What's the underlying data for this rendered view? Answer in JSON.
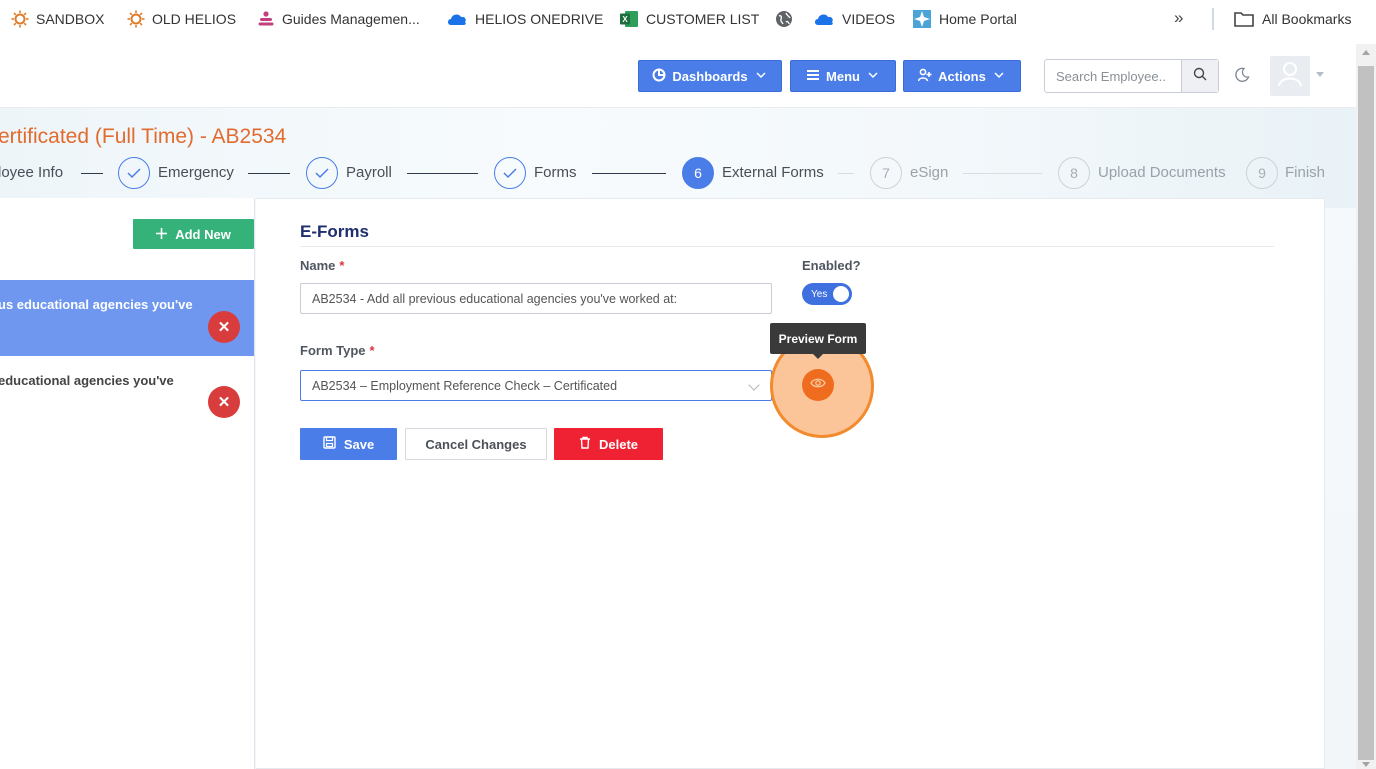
{
  "bookmarks": {
    "items": [
      {
        "label": "SANDBOX",
        "icon": "sun-icon"
      },
      {
        "label": "OLD HELIOS",
        "icon": "sun-icon"
      },
      {
        "label": "Guides Managemen...",
        "icon": "people-icon"
      },
      {
        "label": "HELIOS ONEDRIVE",
        "icon": "cloud-icon"
      },
      {
        "label": "CUSTOMER LIST",
        "icon": "excel-icon"
      },
      {
        "label": "",
        "icon": "globe-icon"
      },
      {
        "label": "VIDEOS",
        "icon": "cloud-icon"
      },
      {
        "label": "Home Portal",
        "icon": "star-icon"
      }
    ],
    "more_label": "»",
    "all_bookmarks_label": "All Bookmarks"
  },
  "header": {
    "dashboards_label": "Dashboards",
    "menu_label": "Menu",
    "actions_label": "Actions",
    "search_placeholder": "Search Employee..",
    "accent_color": "#4a7de8"
  },
  "page": {
    "title": "ertificated (Full Time) - AB2534"
  },
  "stepper": {
    "steps": [
      {
        "label": "loyee Info",
        "state": "done"
      },
      {
        "label": "Emergency",
        "state": "done"
      },
      {
        "label": "Payroll",
        "state": "done"
      },
      {
        "label": "Forms",
        "state": "done"
      },
      {
        "number": "6",
        "label": "External Forms",
        "state": "active"
      },
      {
        "number": "7",
        "label": "eSign",
        "state": "pending"
      },
      {
        "number": "8",
        "label": "Upload Documents",
        "state": "pending"
      },
      {
        "number": "9",
        "label": "Finish",
        "state": "pending"
      }
    ]
  },
  "sidebar": {
    "add_new_label": "Add New",
    "items": [
      {
        "text": "us educational agencies you've",
        "selected": true
      },
      {
        "text": " educational agencies you've",
        "selected": false
      }
    ],
    "remove_symbol": "✕"
  },
  "form": {
    "section_title": "E-Forms",
    "name_label": "Name",
    "name_value": "AB2534 - Add all previous educational agencies you've worked at:",
    "enabled_label": "Enabled?",
    "enabled_value": "Yes",
    "form_type_label": "Form Type",
    "form_type_value": "AB2534 – Employment Reference Check – Certificated",
    "required_marker": "*",
    "preview_tooltip": "Preview Form",
    "save_label": "Save",
    "cancel_label": "Cancel Changes",
    "delete_label": "Delete"
  }
}
